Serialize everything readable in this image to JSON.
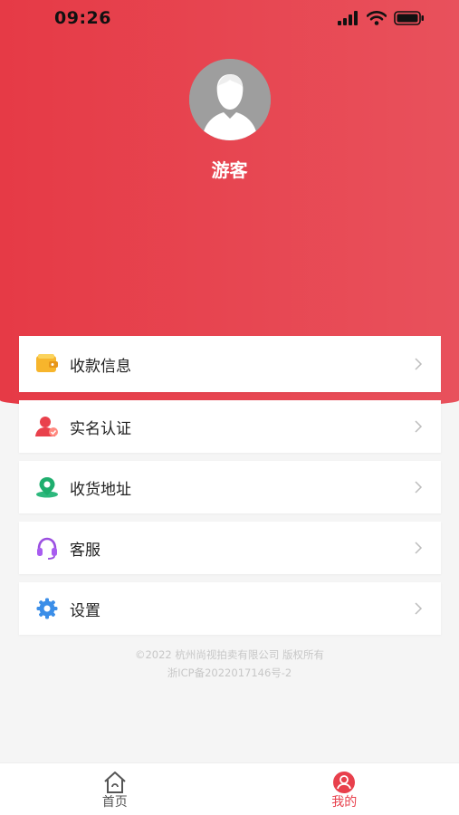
{
  "status_bar": {
    "time": "09:26"
  },
  "profile": {
    "name": "游客"
  },
  "menu": {
    "items": [
      {
        "label": "收款信息",
        "icon": "wallet-icon"
      },
      {
        "label": "实名认证",
        "icon": "user-verify-icon"
      },
      {
        "label": "收货地址",
        "icon": "location-pin-icon"
      },
      {
        "label": "客服",
        "icon": "headset-icon"
      },
      {
        "label": "设置",
        "icon": "gear-icon"
      }
    ]
  },
  "footer": {
    "copyright": "©2022 杭州尚视拍卖有限公司 版权所有",
    "icp": "浙ICP备2022017146号-2"
  },
  "tabbar": {
    "tabs": [
      {
        "label": "首页",
        "icon": "home-icon",
        "active": false
      },
      {
        "label": "我的",
        "icon": "profile-icon",
        "active": true
      }
    ],
    "active_color": "#e8404c",
    "inactive_color": "#555555"
  },
  "colors": {
    "accent": "#e63a46"
  }
}
